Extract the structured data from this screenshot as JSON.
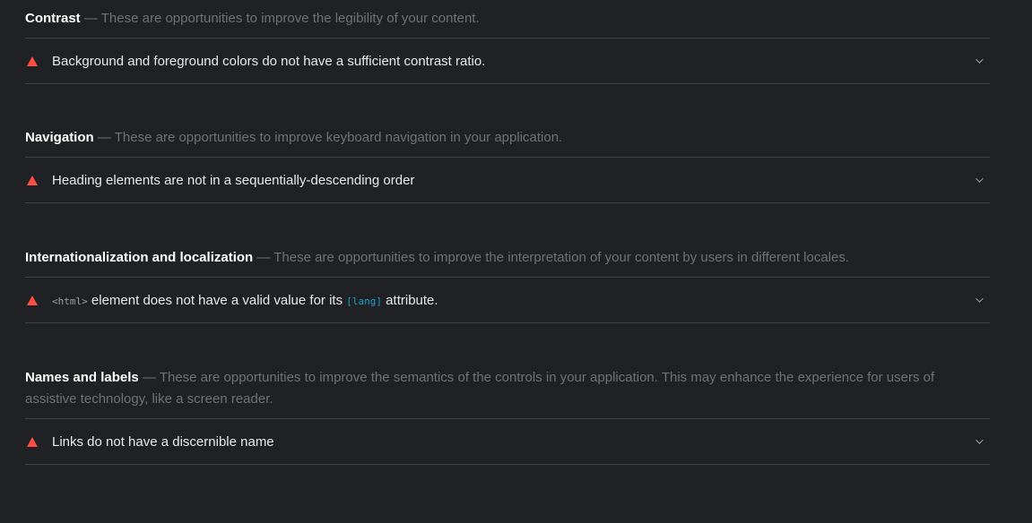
{
  "groups": [
    {
      "title": "Contrast",
      "separator": " — ",
      "description": "These are opportunities to improve the legibility of your content.",
      "audit": {
        "text": "Background and foreground colors do not have a sufficient contrast ratio."
      }
    },
    {
      "title": "Navigation",
      "separator": " — ",
      "description": "These are opportunities to improve keyboard navigation in your application.",
      "audit": {
        "text": "Heading elements are not in a sequentially-descending order"
      }
    },
    {
      "title": "Internationalization and localization",
      "separator": " — ",
      "description": "These are opportunities to improve the interpretation of your content by users in different locales.",
      "audit": {
        "code1": "<html>",
        "text_mid": " element does not have a valid value for its ",
        "code2": "[lang]",
        "text_end": " attribute."
      }
    },
    {
      "title": "Names and labels",
      "separator": " — ",
      "description": "These are opportunities to improve the semantics of the controls in your application. This may enhance the experience for users of assistive technology, like a screen reader.",
      "audit": {
        "text": "Links do not have a discernible name"
      }
    }
  ],
  "colors": {
    "background": "#202124",
    "fail": "#ff4e42",
    "code": "#1a9fcc",
    "divider": "#3c4043"
  },
  "icons": {
    "fail": "triangle-fail-icon",
    "expand": "chevron-down-icon"
  }
}
